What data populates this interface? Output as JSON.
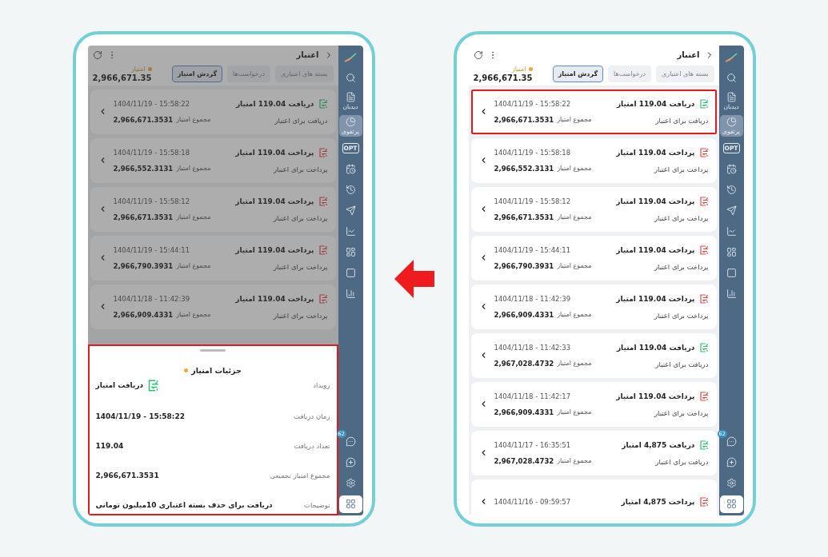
{
  "screens": [
    {
      "dimmed": false,
      "header": {
        "title": "اعتبار"
      },
      "tabs": [
        {
          "label": "بسته های اعتباری",
          "selected": false
        },
        {
          "label": "درخواست‌ها",
          "selected": false
        },
        {
          "label": "گردش امتیاز",
          "selected": true
        }
      ],
      "balance": {
        "label": "امتیاز",
        "value": "2,966,671.35"
      },
      "transactions": [
        {
          "kind": "receive",
          "title": "دریافت 119.04 امتیاز",
          "date": "1404/11/19 - 15:58:22",
          "description": "دریافت برای اعتبار",
          "total_label": "مجموع امتیاز",
          "total": "2,966,671.3531",
          "highlighted": true
        },
        {
          "kind": "pay",
          "title": "پرداخت 119.04 امتیاز",
          "date": "1404/11/19 - 15:58:18",
          "description": "پرداخت برای اعتبار",
          "total_label": "مجموع امتیاز",
          "total": "2,966,552.3131",
          "highlighted": false
        },
        {
          "kind": "pay",
          "title": "پرداخت 119.04 امتیاز",
          "date": "1404/11/19 - 15:58:12",
          "description": "پرداخت برای اعتبار",
          "total_label": "مجموع امتیاز",
          "total": "2,966,671.3531",
          "highlighted": false
        },
        {
          "kind": "pay",
          "title": "پرداخت 119.04 امتیاز",
          "date": "1404/11/19 - 15:44:11",
          "description": "پرداخت برای اعتبار",
          "total_label": "مجموع امتیاز",
          "total": "2,966,790.3931",
          "highlighted": false
        },
        {
          "kind": "pay",
          "title": "پرداخت 119.04 امتیاز",
          "date": "1404/11/18 - 11:42:39",
          "description": "پرداخت برای اعتبار",
          "total_label": "مجموع امتیاز",
          "total": "2,966,909.4331",
          "highlighted": false
        },
        {
          "kind": "receive",
          "title": "دریافت 119.04 امتیاز",
          "date": "1404/11/18 - 11:42:33",
          "description": "دریافت برای اعتبار",
          "total_label": "مجموع امتیاز",
          "total": "2,967,028.4732",
          "highlighted": false
        },
        {
          "kind": "pay",
          "title": "پرداخت 119.04 امتیاز",
          "date": "1404/11/18 - 11:42:17",
          "description": "پرداخت برای اعتبار",
          "total_label": "مجموع امتیاز",
          "total": "2,966,909.4331",
          "highlighted": false
        },
        {
          "kind": "receive",
          "title": "دریافت 4,875 امتیاز",
          "date": "1404/11/17 - 16:35:51",
          "description": "دریافت برای اعتبار",
          "total_label": "مجموع امتیاز",
          "total": "2,967,028.4732",
          "highlighted": false
        },
        {
          "kind": "pay",
          "title": "پرداخت 4,875 امتیاز",
          "date": "1404/11/16 - 09:59:57",
          "highlighted": false
        }
      ],
      "sidebar": [
        {
          "selected": false
        },
        {
          "selected": false
        },
        {
          "label": "دیدبان",
          "selected": false
        },
        {
          "label": "پرتفوی",
          "selected": true
        },
        {
          "glyph": "OPT",
          "selected": false
        },
        {
          "selected": false
        },
        {
          "selected": false
        },
        {
          "selected": false
        },
        {
          "selected": false
        },
        {
          "selected": false
        },
        {
          "selected": false
        },
        {
          "selected": false
        },
        {
          "badge": "62",
          "selected": false
        },
        {
          "selected": false
        },
        {
          "selected": false
        },
        {
          "selected": true
        }
      ]
    },
    {
      "dimmed": true,
      "header": {
        "title": "اعتبار"
      },
      "tabs": [
        {
          "label": "بسته های اعتباری",
          "selected": false
        },
        {
          "label": "درخواست‌ها",
          "selected": false
        },
        {
          "label": "گردش امتیاز",
          "selected": true
        }
      ],
      "balance": {
        "label": "امتیاز",
        "value": "2,966,671.35"
      },
      "transactions": [
        {
          "kind": "receive",
          "title": "دریافت 119.04 امتیاز",
          "date": "1404/11/19 - 15:58:22",
          "description": "دریافت برای اعتبار",
          "total_label": "مجموع امتیاز",
          "total": "2,966,671.3531",
          "highlighted": false
        },
        {
          "kind": "pay",
          "title": "پرداخت 119.04 امتیاز",
          "date": "1404/11/19 - 15:58:18",
          "description": "پرداخت برای اعتبار",
          "total_label": "مجموع امتیاز",
          "total": "2,966,552.3131",
          "highlighted": false
        },
        {
          "kind": "pay",
          "title": "پرداخت 119.04 امتیاز",
          "date": "1404/11/19 - 15:58:12",
          "description": "پرداخت برای اعتبار",
          "total_label": "مجموع امتیاز",
          "total": "2,966,671.3531",
          "highlighted": false
        },
        {
          "kind": "pay",
          "title": "پرداخت 119.04 امتیاز",
          "date": "1404/11/19 - 15:44:11",
          "description": "پرداخت برای اعتبار",
          "total_label": "مجموع امتیاز",
          "total": "2,966,790.3931",
          "highlighted": false
        },
        {
          "kind": "pay",
          "title": "پرداخت 119.04 امتیاز",
          "date": "1404/11/18 - 11:42:39",
          "description": "پرداخت برای اعتبار",
          "total_label": "مجموع امتیاز",
          "total": "2,966,909.4331",
          "highlighted": false
        }
      ],
      "sheet": {
        "title": "جزئیات امتیاز",
        "rows": [
          {
            "kind": "event",
            "label": "رویداد",
            "value": "دریافت امتیاز"
          },
          {
            "kind": "text",
            "label": "زمان دریافت",
            "value": "1404/11/19 - 15:58:22"
          },
          {
            "kind": "text",
            "label": "تعداد دریافت",
            "value": "119.04"
          },
          {
            "kind": "text",
            "label": "مجموع امتیاز تجمیعی",
            "value": "2,966,671.3531"
          },
          {
            "kind": "text",
            "label": "توضیحات",
            "value": "دریافت برای حذف بسته اعتباری 10میلیون تومانی"
          }
        ]
      },
      "sidebar": [
        {
          "selected": false
        },
        {
          "selected": false
        },
        {
          "label": "دیدبان",
          "selected": false
        },
        {
          "label": "پرتفوی",
          "selected": true
        },
        {
          "glyph": "OPT",
          "selected": false
        },
        {
          "selected": false
        },
        {
          "selected": false
        },
        {
          "selected": false
        },
        {
          "selected": false
        },
        {
          "selected": false
        },
        {
          "selected": false
        },
        {
          "selected": false
        },
        {
          "badge": "62",
          "selected": false
        },
        {
          "selected": false
        },
        {
          "selected": false
        },
        {
          "selected": true
        }
      ]
    }
  ]
}
